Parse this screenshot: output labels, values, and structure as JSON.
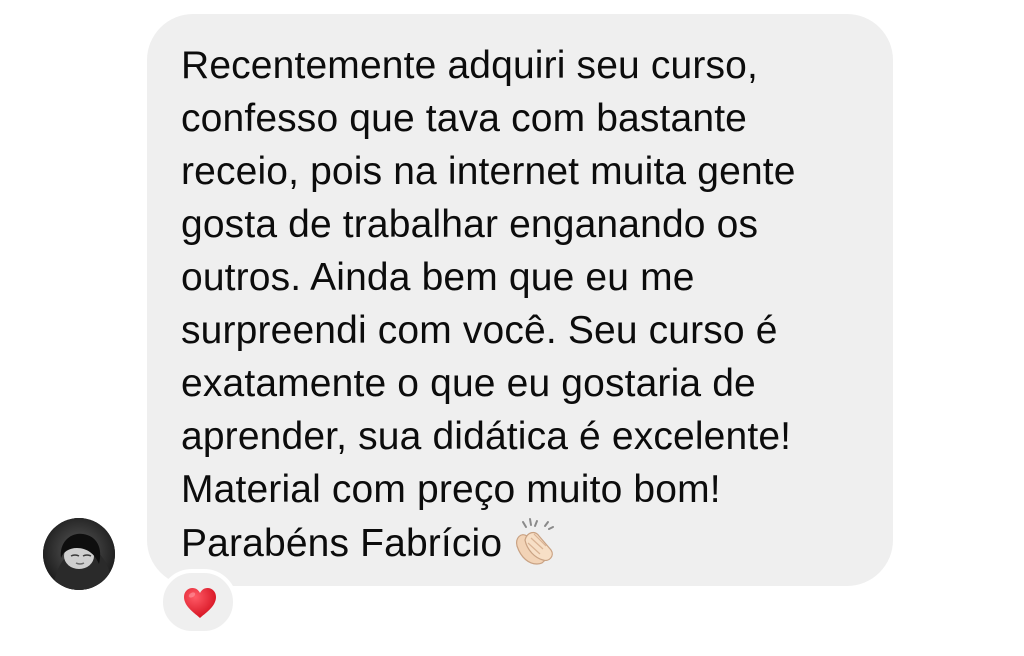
{
  "message": {
    "lines": [
      "Recentemente adquiri seu curso,",
      "confesso que tava com bastante",
      "receio, pois na internet muita gente",
      "gosta de trabalhar enganando os",
      "outros. Ainda bem que eu me",
      "surpreendi com você. Seu curso é",
      "exatamente o que eu gostaria de",
      "aprender, sua didática é excelente!",
      "Material com preço muito bom!",
      "Parabéns Fabrício"
    ],
    "trailing_emoji": "clapping-hands-icon",
    "bubble_color": "#efefef",
    "text_color": "#0c0c0c"
  },
  "sender": {
    "avatar_icon": "user-avatar"
  },
  "reaction": {
    "icon": "red-heart-icon",
    "color": "#e0162b"
  }
}
